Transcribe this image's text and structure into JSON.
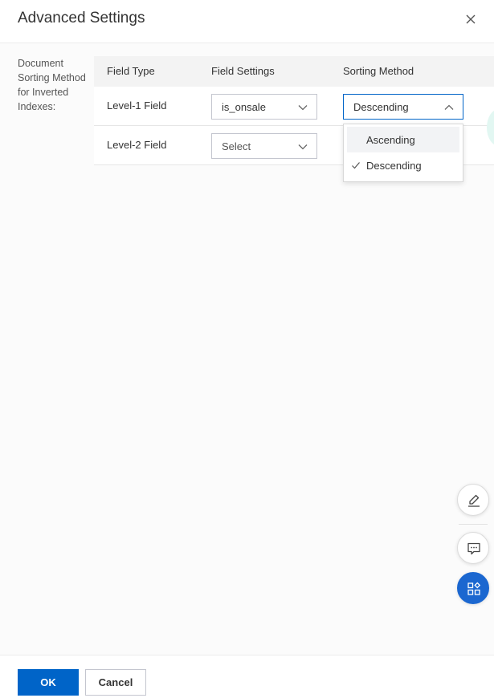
{
  "dialog": {
    "title": "Advanced Settings"
  },
  "section": {
    "label": "Document Sorting Method for Inverted Indexes:"
  },
  "table": {
    "headers": [
      "Field Type",
      "Field Settings",
      "Sorting Method"
    ],
    "rows": [
      {
        "field_type": "Level-1 Field",
        "field_setting": "is_onsale",
        "sorting_method": "Descending"
      },
      {
        "field_type": "Level-2 Field",
        "field_setting": "Select"
      }
    ]
  },
  "dropdown": {
    "options": [
      {
        "label": "Ascending",
        "selected": false
      },
      {
        "label": "Descending",
        "selected": true
      }
    ]
  },
  "footer": {
    "ok_label": "OK",
    "cancel_label": "Cancel"
  },
  "colors": {
    "primary": "#0064c8",
    "float_primary": "#1b67d0"
  },
  "icons": {
    "close": "close-icon",
    "chevron": "chevron-down-icon",
    "check": "check-icon",
    "edit": "edit-icon",
    "feedback": "chat-icon",
    "apps": "apps-icon"
  }
}
